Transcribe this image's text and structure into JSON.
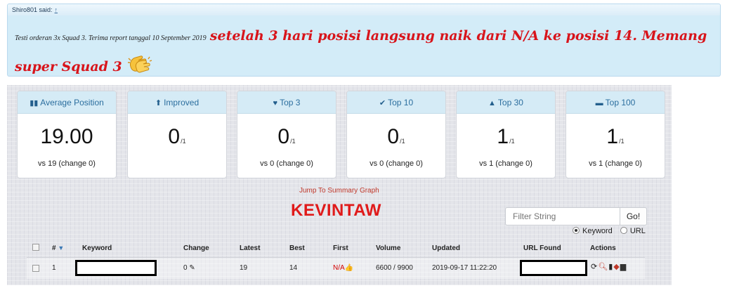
{
  "quote": {
    "author": "Shiro801 said:",
    "arrow": "↑",
    "small_text": "Testi orderan 3x Squad 3. Terima report tanggal 10 September 2019",
    "big_text": "setelah 3 hari posisi langsung naik dari N/A ke posisi 14. Memang super Squad 3"
  },
  "stats": [
    {
      "icon": "bar-chart-icon",
      "glyph": "▮",
      "label": "Average Position",
      "value": "19.00",
      "sub": "",
      "foot": "vs 19 (change 0)"
    },
    {
      "icon": "arrow-up-icon",
      "glyph": "⬆",
      "label": "Improved",
      "value": "0",
      "sub": "/1",
      "foot": ""
    },
    {
      "icon": "heart-icon",
      "glyph": "♥",
      "label": "Top 3",
      "value": "0",
      "sub": "/1",
      "foot": "vs 0 (change 0)"
    },
    {
      "icon": "check-icon",
      "glyph": "✔",
      "label": "Top 10",
      "value": "0",
      "sub": "/1",
      "foot": "vs 0 (change 0)"
    },
    {
      "icon": "road-icon",
      "glyph": "⛰",
      "label": "Top 30",
      "value": "1",
      "sub": "/1",
      "foot": "vs 1 (change 0)"
    },
    {
      "icon": "briefcase-icon",
      "glyph": "▬",
      "label": "Top 100",
      "value": "1",
      "sub": "/1",
      "foot": "vs 1 (change 0)"
    }
  ],
  "jump_link": "Jump To Summary Graph",
  "brand": "KEVINTAW",
  "filter": {
    "placeholder": "Filter String",
    "button": "Go!"
  },
  "radio": {
    "option1": "Keyword",
    "option2": "URL",
    "selected": "Keyword"
  },
  "table": {
    "headers": {
      "num": "#",
      "keyword": "Keyword",
      "change": "Change",
      "latest": "Latest",
      "best": "Best",
      "first": "First",
      "volume": "Volume",
      "updated": "Updated",
      "url": "URL Found",
      "actions": "Actions"
    },
    "rows": [
      {
        "num": "1",
        "keyword": "",
        "change": "0",
        "latest": "19",
        "best": "14",
        "first": "N/A",
        "volume": "6600 / 9900",
        "updated": "2019-09-17 11:22:20",
        "url": ""
      }
    ]
  }
}
